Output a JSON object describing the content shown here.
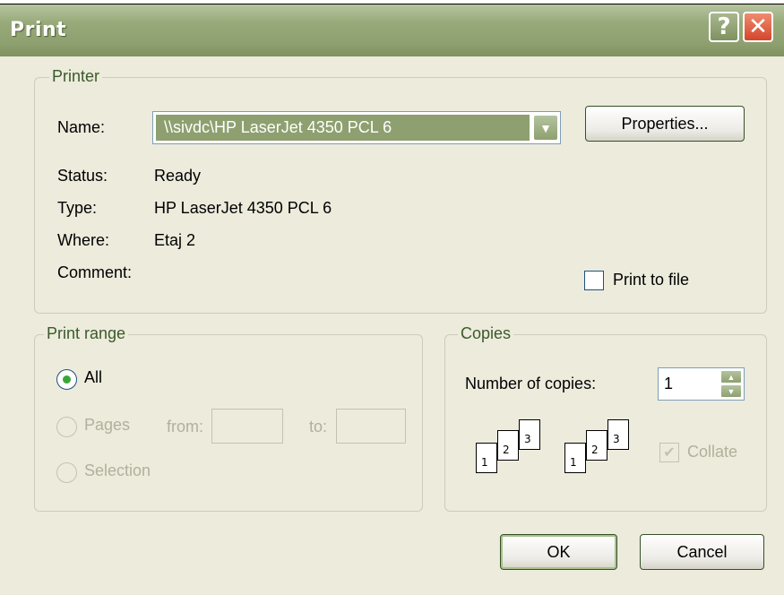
{
  "window": {
    "title": "Print",
    "help_button": "?",
    "close_button": "✕"
  },
  "printer": {
    "legend": "Printer",
    "name_label": "Name:",
    "name_value": "\\\\sivdc\\HP LaserJet 4350 PCL 6",
    "properties_button": "Properties...",
    "status_label": "Status:",
    "status_value": "Ready",
    "type_label": "Type:",
    "type_value": "HP LaserJet 4350 PCL 6",
    "where_label": "Where:",
    "where_value": "Etaj 2",
    "comment_label": "Comment:",
    "print_to_file_label": "Print to file",
    "print_to_file_checked": false
  },
  "print_range": {
    "legend": "Print range",
    "all_label": "All",
    "pages_label": "Pages",
    "from_label": "from:",
    "to_label": "to:",
    "from_value": "",
    "to_value": "",
    "selection_label": "Selection",
    "selected": "All"
  },
  "copies": {
    "legend": "Copies",
    "number_label": "Number of copies:",
    "number_value": "1",
    "collate_label": "Collate",
    "collate_checked": true,
    "collate_pages": [
      "1",
      "2",
      "3"
    ]
  },
  "buttons": {
    "ok": "OK",
    "cancel": "Cancel"
  },
  "colors": {
    "titlebar": "#8ea06f",
    "dialog_bg": "#ecebdc",
    "legend_text": "#3a5a2a",
    "radio_dot": "#3aa63a",
    "close_button": "#d4452b"
  }
}
